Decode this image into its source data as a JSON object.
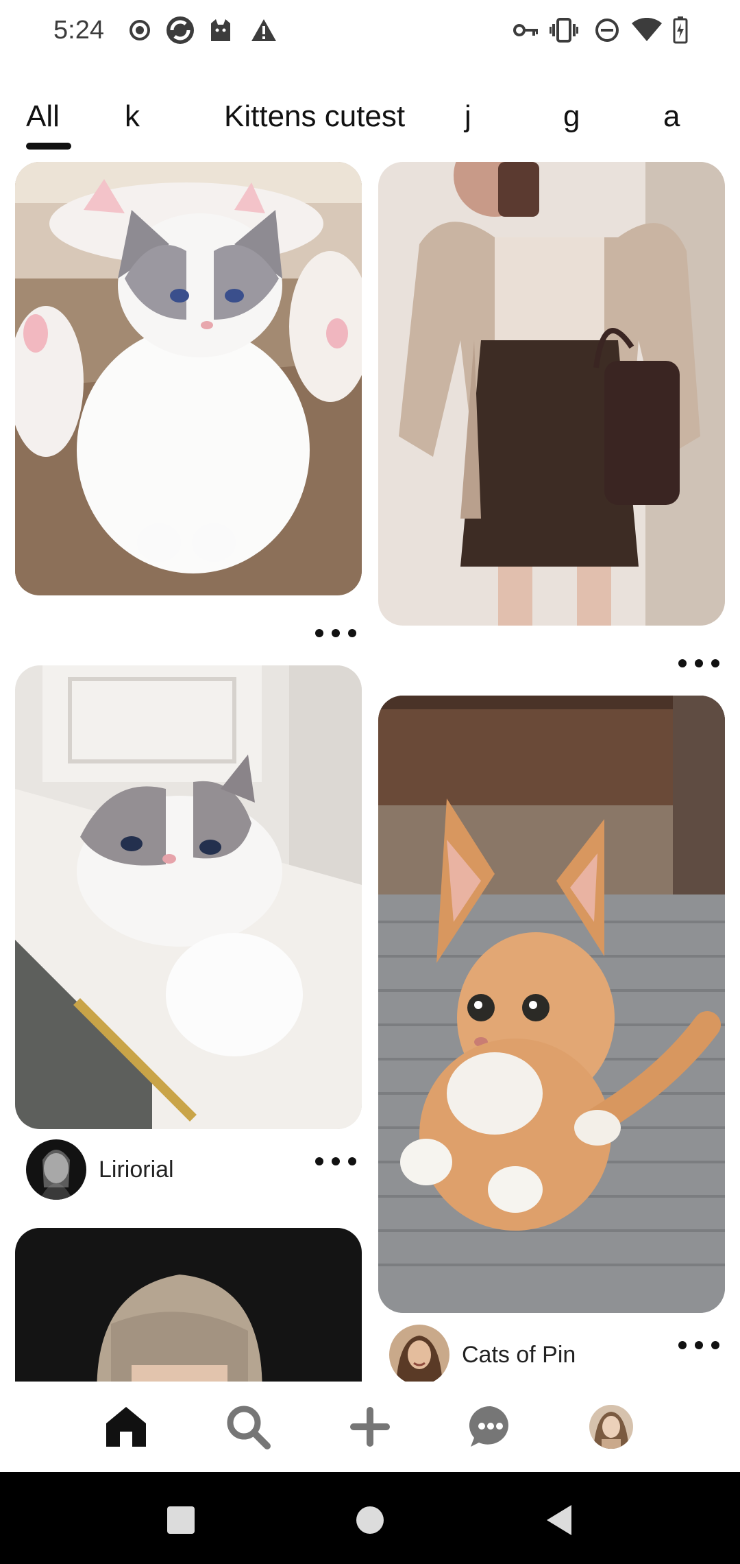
{
  "status_bar": {
    "time": "5:24",
    "left_icons": [
      "record-icon",
      "data-saver-icon",
      "cat-app-icon",
      "warning-icon"
    ],
    "right_icons": [
      "vpn-key-icon",
      "vibrate-icon",
      "do-not-disturb-icon",
      "wifi-icon",
      "battery-icon"
    ]
  },
  "tabs": [
    {
      "label": "All",
      "selected": true
    },
    {
      "label": "k",
      "selected": false
    },
    {
      "label": "Kittens cutest",
      "selected": false
    },
    {
      "label": "j",
      "selected": false
    },
    {
      "label": "g",
      "selected": false
    },
    {
      "label": "a",
      "selected": false
    }
  ],
  "pins": [
    {
      "subject": "ragdoll cat sitting by plush slippers",
      "author": ""
    },
    {
      "subject": "person in beige cardigan and brown skirt",
      "author": ""
    },
    {
      "subject": "ragdoll cat peeking from drawer",
      "author": "Liriorial"
    },
    {
      "subject": "orange kitten on grey rug",
      "author": "Cats of Pin"
    },
    {
      "subject": "portrait with ash-blond hair",
      "author": ""
    }
  ],
  "bottom_nav": [
    {
      "icon": "home-icon",
      "active": true
    },
    {
      "icon": "search-icon",
      "active": false
    },
    {
      "icon": "plus-icon",
      "active": false
    },
    {
      "icon": "chat-icon",
      "active": false
    },
    {
      "icon": "profile-avatar",
      "active": false
    }
  ],
  "system_nav": [
    "recents-button",
    "home-button",
    "back-button"
  ],
  "colors": {
    "text": "#111111",
    "status_icons": "#3c3c3c",
    "nav_bar": "#000000",
    "icon_grey": "#767676"
  }
}
